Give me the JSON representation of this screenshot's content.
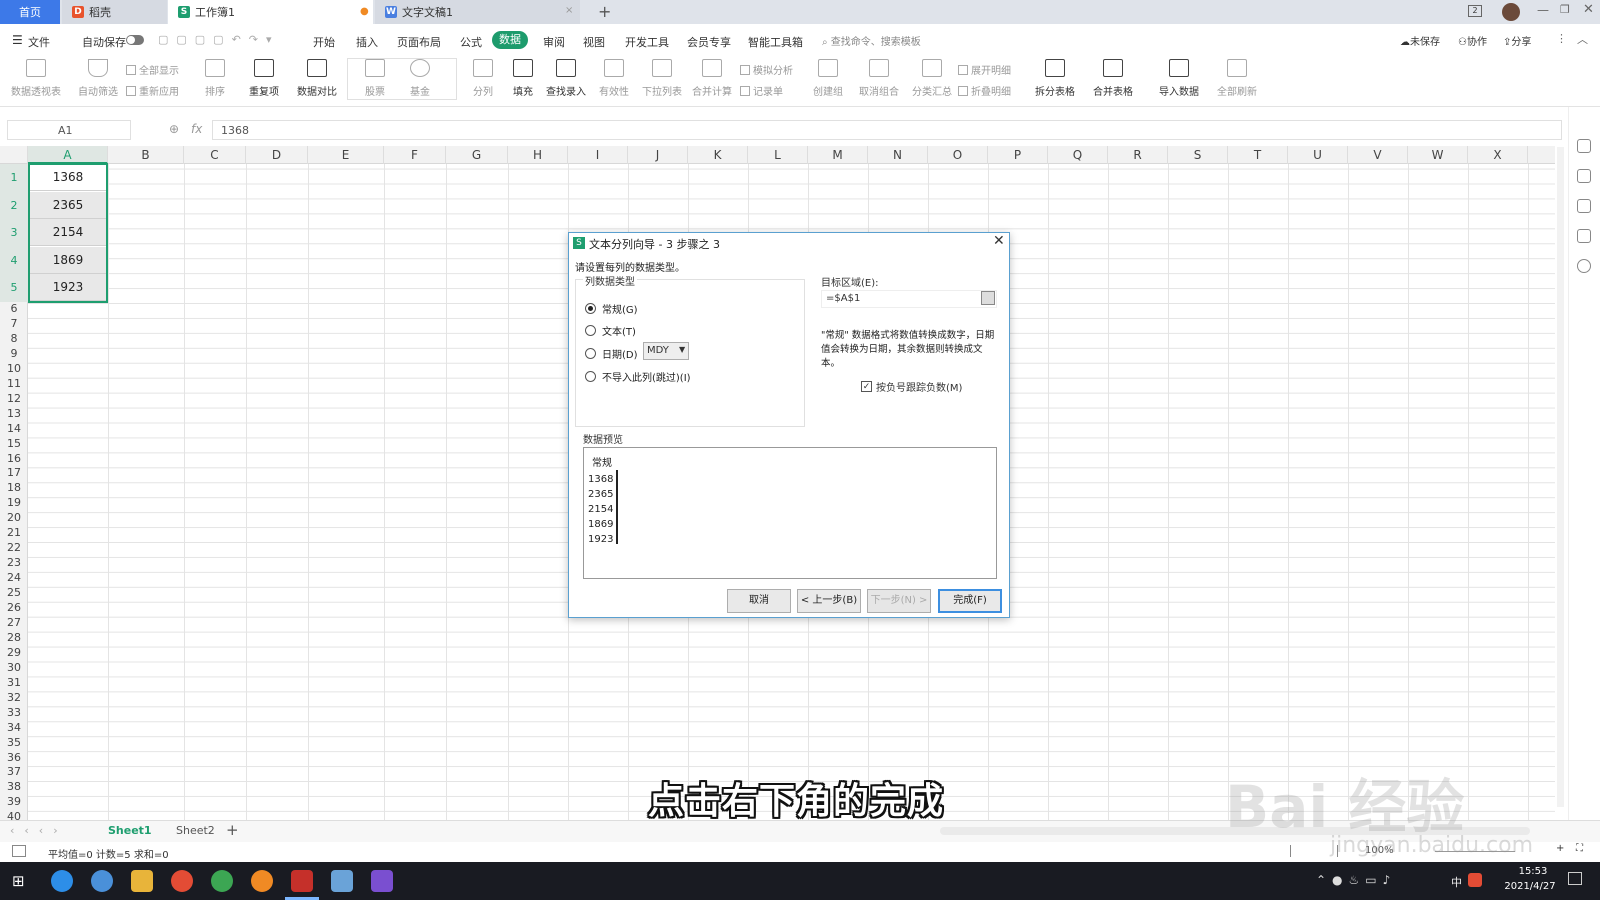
{
  "tabs": {
    "home": "首页",
    "daoke": "稻壳",
    "workbook": "工作簿1",
    "doc": "文字文稿1",
    "add": "+"
  },
  "menubar": {
    "file": "文件",
    "autosave": "自动保存",
    "items": [
      "开始",
      "插入",
      "页面布局",
      "公式",
      "数据",
      "审阅",
      "视图",
      "开发工具",
      "会员专享",
      "智能工具箱"
    ],
    "search_placeholder": "查找命令、搜索模板",
    "unsaved": "未保存",
    "collab": "协作",
    "share": "分享"
  },
  "ribbon": {
    "pivot": "数据透视表",
    "autofilter": "自动筛选",
    "showall": "全部显示",
    "reapply": "重新应用",
    "sort": "排序",
    "duplicates": "重复项",
    "compare": "数据对比",
    "stocks": "股票",
    "fund": "基金",
    "split": "分列",
    "fill": "填充",
    "lookup": "查找录入",
    "validity": "有效性",
    "dropdown": "下拉列表",
    "consolidate": "合并计算",
    "whatif": "模拟分析",
    "record": "记录单",
    "group": "创建组",
    "ungroup": "取消组合",
    "subtotal": "分类汇总",
    "expand": "展开明细",
    "collapse": "折叠明细",
    "splittable": "拆分表格",
    "mergetable": "合并表格",
    "import": "导入数据",
    "refresh": "全部刷新"
  },
  "formula": {
    "cell_ref": "A1",
    "fx": "fx",
    "value": "1368"
  },
  "columns": [
    "A",
    "B",
    "C",
    "D",
    "E",
    "F",
    "G",
    "H",
    "I",
    "J",
    "K",
    "L",
    "M",
    "N",
    "O",
    "P",
    "Q",
    "R",
    "S",
    "T",
    "U",
    "V",
    "W",
    "X"
  ],
  "rows": [
    "1",
    "2",
    "3",
    "4",
    "5",
    "6",
    "7",
    "8",
    "9",
    "10",
    "11",
    "12",
    "13",
    "14",
    "15",
    "16",
    "17",
    "18",
    "19",
    "20",
    "21",
    "22",
    "23",
    "24",
    "25",
    "26",
    "27",
    "28",
    "29",
    "30",
    "31",
    "32",
    "33",
    "34",
    "35",
    "36",
    "37",
    "38",
    "39",
    "40"
  ],
  "cells": [
    "1368",
    "2365",
    "2154",
    "1869",
    "1923"
  ],
  "dialog": {
    "title": "文本分列向导 - 3 步骤之 3",
    "instruction": "请设置每列的数据类型。",
    "group_label": "列数据类型",
    "opt_general": "常规(G)",
    "opt_text": "文本(T)",
    "opt_date": "日期(D)",
    "date_format": "MDY",
    "opt_skip": "不导入此列(跳过)(I)",
    "target_label": "目标区域(E):",
    "target_value": "=$A$1",
    "note": "\"常规\" 数据格式将数值转换成数字，日期值会转换为日期，其余数据则转换成文本。",
    "checkbox": "按负号跟踪负数(M)",
    "preview_label": "数据预览",
    "preview_header": "常规",
    "preview_values": [
      "1368",
      "2365",
      "2154",
      "1869",
      "1923"
    ],
    "btn_cancel": "取消",
    "btn_back": "< 上一步(B)",
    "btn_next": "下一步(N) >",
    "btn_finish": "完成(F)"
  },
  "sheets": {
    "sheet1": "Sheet1",
    "sheet2": "Sheet2",
    "add": "+"
  },
  "status": {
    "summary": "平均值=0  计数=5  求和=0",
    "zoom": "100%"
  },
  "caption": "点击右下角的完成",
  "watermark": "Bai 经验",
  "watermark_url": "jingyan.baidu.com",
  "taskbar": {
    "time": "15:53",
    "date": "2021/4/27",
    "ime": "中"
  },
  "colors": {
    "accent": "#1e9e6f",
    "tab_blue": "#3d79e8",
    "data_tab": "#1d9b6c"
  }
}
